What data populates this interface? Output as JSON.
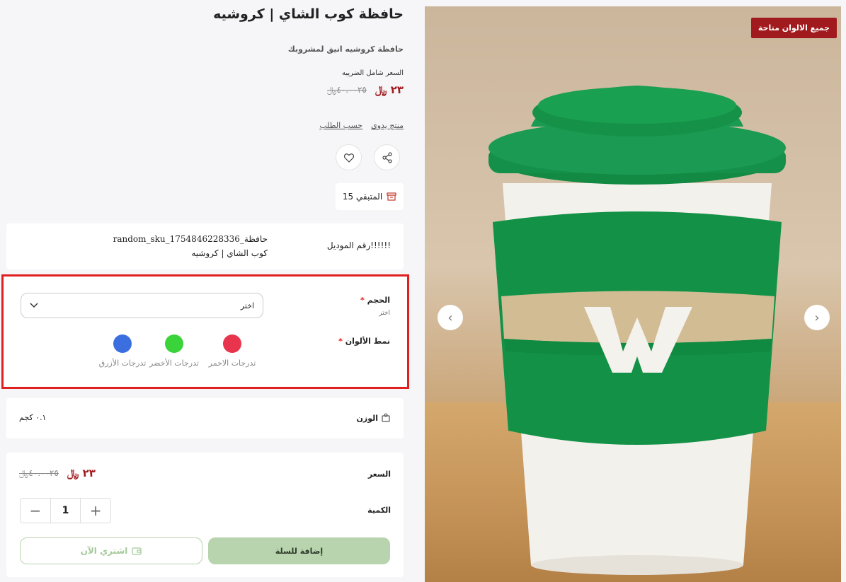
{
  "product": {
    "title": "حافظة كوب الشاي | كروشيه",
    "subtitle": "حافظة كروشيه انيق لمشروبك",
    "tax_note": "السعر شامل الضريبه",
    "price_now": "٢٣",
    "price_old": "٤٠.٠٠٢٥",
    "currency": "﷼",
    "tags": [
      "منتج يدوي",
      "حسب الطلب"
    ],
    "stock_text": "المتبقي 15"
  },
  "gallery": {
    "badge": "جميع الالوان متاحة",
    "prev_icon": "chevron-left-icon",
    "next_icon": "chevron-right-icon",
    "cup_letter": "W"
  },
  "model": {
    "label": "!!!!!!رقم الموديل",
    "sku": "حافظة_random_sku_1754846228336",
    "name": "كوب الشاي | كروشيه"
  },
  "options": {
    "size_label": "الحجم",
    "size_hint": "اختر",
    "size_value": "اختر",
    "colors_label": "نمط الألوان",
    "colors": [
      {
        "label": "تدرجات الاحمر",
        "color": "#e8344c"
      },
      {
        "label": "تدرجات الأخضر",
        "color": "#3ad43a"
      },
      {
        "label": "تدرجات الأزرق",
        "color": "#3b6fe0"
      }
    ]
  },
  "weight": {
    "label": "الوزن",
    "value": "٠.١ كجم"
  },
  "purchase": {
    "price_label": "السعر",
    "price_now": "٢٣",
    "price_old": "٤٠.٠٠٢٥",
    "qty_label": "الكمية",
    "qty_value": "1",
    "add_to_cart": "إضافة للسلة",
    "buy_now": "اشتري الآن"
  }
}
